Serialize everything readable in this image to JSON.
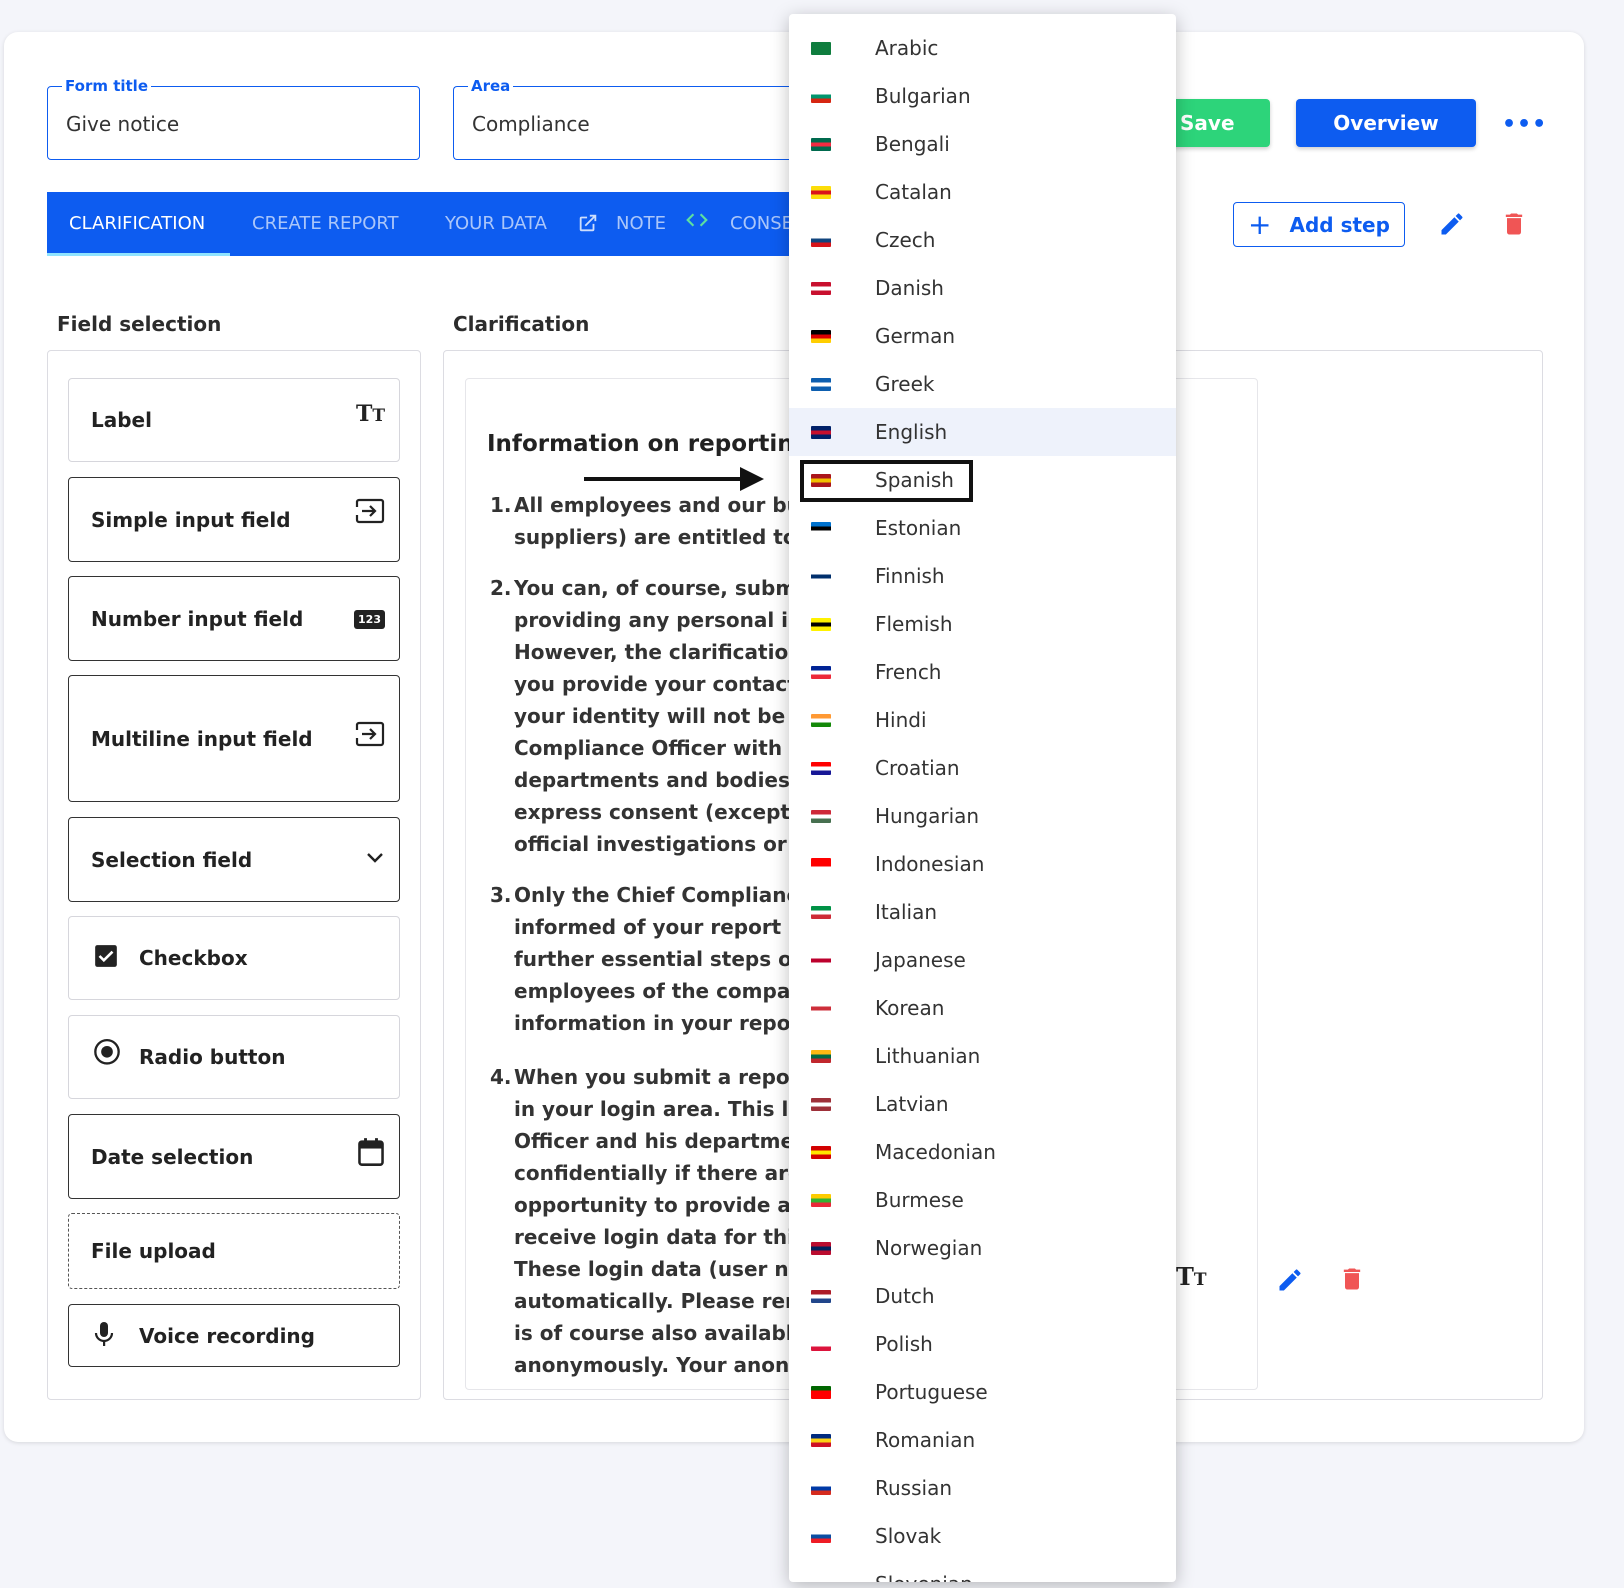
{
  "form": {
    "title_label": "Form title",
    "title_value": "Give notice",
    "area_label": "Area",
    "area_value": "Compliance"
  },
  "toolbar": {
    "save_label": "Save",
    "overview_label": "Overview",
    "more_label": "•••",
    "add_step_label": "Add step",
    "add_step_icon": "+"
  },
  "tabs": [
    {
      "label": "CLARIFICATION"
    },
    {
      "label": "CREATE REPORT"
    },
    {
      "label": "YOUR DATA"
    },
    {
      "label": "NOTE"
    },
    {
      "label": "CONSE"
    }
  ],
  "sections": {
    "field_selection": "Field selection",
    "clarification": "Clarification"
  },
  "field_types": [
    {
      "label": "Label",
      "icon": "text-size-icon",
      "glyph": "TT"
    },
    {
      "label": "Simple input field",
      "icon": "input-icon",
      "glyph": "⇥"
    },
    {
      "label": "Number input field",
      "icon": "numeric-icon",
      "glyph": "123"
    },
    {
      "label": "Multiline input field",
      "icon": "input-icon",
      "glyph": "⇥"
    },
    {
      "label": "Selection field",
      "icon": "chevron-down-icon",
      "glyph": "⌄"
    },
    {
      "label": "Checkbox",
      "icon": "checkbox-icon",
      "glyph": "✔"
    },
    {
      "label": "Radio button",
      "icon": "radio-icon",
      "glyph": "◉"
    },
    {
      "label": "Date selection",
      "icon": "calendar-icon",
      "glyph": "▦"
    },
    {
      "label": "File upload",
      "icon": "",
      "glyph": ""
    },
    {
      "label": "Voice recording",
      "icon": "microphone-icon",
      "glyph": "🎙"
    }
  ],
  "content": {
    "title": "Information on reporting v",
    "paragraphs": [
      {
        "num": "1.",
        "lines": "All employees and our busir\nsuppliers) are entitled to sul"
      },
      {
        "num": "2.",
        "lines": "You can, of course, submit yo\nproviding any personal infor\nHowever, the clarification of\nyou provide your contact inf\nyour identity will not be disc\nCompliance Officer with his\ndepartments and bodies tha\nexpress consent (exceptions\nofficial investigations or lega"
      },
      {
        "num": "3.",
        "lines": "Only the Chief Compliance C\ninformed of your report in a\nfurther essential steps of th\nemployees of the company v\ninformation in your report w"
      },
      {
        "num": "4.",
        "lines": "When you submit a report, y\nin your login area. This login\nOfficer and his department t\nconfidentially if there are an\nopportunity to provide addit\nreceive login data for this pu\nThese login data (user name\nautomatically. Please remen\nis of course also available to\nanonymously. Your anonymi"
      }
    ]
  },
  "languages": [
    {
      "name": "Arabic",
      "flag": [
        "#0f7d3e",
        "#0f7d3e",
        "#0f7d3e"
      ]
    },
    {
      "name": "Bulgarian",
      "flag": [
        "#ffffff",
        "#00966e",
        "#d62612"
      ]
    },
    {
      "name": "Bengali",
      "flag": [
        "#006a4e",
        "#f42a41",
        "#006a4e"
      ]
    },
    {
      "name": "Catalan",
      "flag": [
        "#fcdd09",
        "#da121a",
        "#fcdd09"
      ]
    },
    {
      "name": "Czech",
      "flag": [
        "#ffffff",
        "#11457e",
        "#d7141a"
      ]
    },
    {
      "name": "Danish",
      "flag": [
        "#c8102e",
        "#ffffff",
        "#c8102e"
      ]
    },
    {
      "name": "German",
      "flag": [
        "#000000",
        "#dd0000",
        "#ffce00"
      ]
    },
    {
      "name": "Greek",
      "flag": [
        "#0d5eaf",
        "#ffffff",
        "#0d5eaf"
      ]
    },
    {
      "name": "English",
      "flag": [
        "#012169",
        "#c8102e",
        "#012169"
      ]
    },
    {
      "name": "Spanish",
      "flag": [
        "#aa151b",
        "#f1bf00",
        "#aa151b"
      ]
    },
    {
      "name": "Estonian",
      "flag": [
        "#0072ce",
        "#000000",
        "#ffffff"
      ]
    },
    {
      "name": "Finnish",
      "flag": [
        "#ffffff",
        "#002f6c",
        "#ffffff"
      ]
    },
    {
      "name": "Flemish",
      "flag": [
        "#fff200",
        "#000000",
        "#fff200"
      ]
    },
    {
      "name": "French",
      "flag": [
        "#002395",
        "#ffffff",
        "#ed2939"
      ]
    },
    {
      "name": "Hindi",
      "flag": [
        "#ff9933",
        "#ffffff",
        "#138808"
      ]
    },
    {
      "name": "Croatian",
      "flag": [
        "#ff0000",
        "#ffffff",
        "#171796"
      ]
    },
    {
      "name": "Hungarian",
      "flag": [
        "#ce2939",
        "#ffffff",
        "#477050"
      ]
    },
    {
      "name": "Indonesian",
      "flag": [
        "#ff0000",
        "#ff0000",
        "#ffffff"
      ]
    },
    {
      "name": "Italian",
      "flag": [
        "#009246",
        "#ffffff",
        "#ce2b37"
      ]
    },
    {
      "name": "Japanese",
      "flag": [
        "#ffffff",
        "#bc002d",
        "#ffffff"
      ]
    },
    {
      "name": "Korean",
      "flag": [
        "#ffffff",
        "#cd2e3a",
        "#ffffff"
      ]
    },
    {
      "name": "Lithuanian",
      "flag": [
        "#fdb913",
        "#006a44",
        "#c1272d"
      ]
    },
    {
      "name": "Latvian",
      "flag": [
        "#9e3039",
        "#ffffff",
        "#9e3039"
      ]
    },
    {
      "name": "Macedonian",
      "flag": [
        "#d20000",
        "#ffe600",
        "#d20000"
      ]
    },
    {
      "name": "Burmese",
      "flag": [
        "#fecb00",
        "#34b233",
        "#ea2839"
      ]
    },
    {
      "name": "Norwegian",
      "flag": [
        "#ba0c2f",
        "#00205b",
        "#ba0c2f"
      ]
    },
    {
      "name": "Dutch",
      "flag": [
        "#ae1c28",
        "#ffffff",
        "#21468b"
      ]
    },
    {
      "name": "Polish",
      "flag": [
        "#ffffff",
        "#ffffff",
        "#dc143c"
      ]
    },
    {
      "name": "Portuguese",
      "flag": [
        "#006600",
        "#ff0000",
        "#ff0000"
      ]
    },
    {
      "name": "Romanian",
      "flag": [
        "#002b7f",
        "#fcd116",
        "#ce1126"
      ]
    },
    {
      "name": "Russian",
      "flag": [
        "#ffffff",
        "#0039a6",
        "#d52b1e"
      ]
    },
    {
      "name": "Slovak",
      "flag": [
        "#ffffff",
        "#0b4ea2",
        "#ee1c25"
      ]
    },
    {
      "name": "Slovenian",
      "flag": [
        "#ffffff",
        "#0000ff",
        "#ff0000"
      ]
    }
  ],
  "selected_language": "English",
  "highlighted_language": "Spanish",
  "colors": {
    "primary": "#0d5cf0",
    "save": "#2dd47a",
    "delete": "#f05555"
  }
}
